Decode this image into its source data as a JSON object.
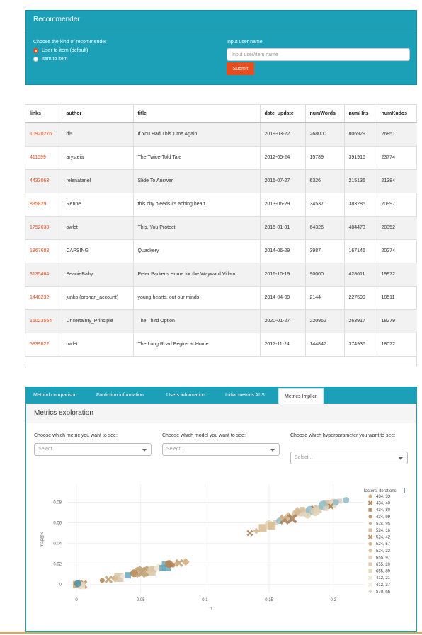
{
  "recommender": {
    "title": "Recommender",
    "kind_label": "Choose the kind of recommender",
    "options": [
      "User to item (default)",
      "Item to item"
    ],
    "selected_index": 0,
    "input_label": "Input user name",
    "input_placeholder": "Input user/item name",
    "submit_label": "Submit"
  },
  "table": {
    "columns": [
      "links",
      "author",
      "title",
      "date_update",
      "numWords",
      "numHits",
      "numKudos"
    ],
    "rows": [
      [
        "10920276",
        "dls",
        "If You Had This Time Again",
        "2019-03-22",
        "268000",
        "806929",
        "26851"
      ],
      [
        "411599",
        "arysteia",
        "The Twice-Told Tale",
        "2012-05-24",
        "15789",
        "391916",
        "23774"
      ],
      [
        "4433063",
        "relenafanel",
        "Slide To Answer",
        "2015-07-27",
        "6326",
        "215136",
        "21384"
      ],
      [
        "835829",
        "Renne",
        "this city bleeds its aching heart",
        "2013-06-29",
        "34537",
        "383285",
        "20997"
      ],
      [
        "1752638",
        "owlet",
        "This, You Protect",
        "2015-01-01",
        "64326",
        "484473",
        "20352"
      ],
      [
        "1867683",
        "CAPSING",
        "Quackery",
        "2014-06-29",
        "3987",
        "167146",
        "20274"
      ],
      [
        "3135464",
        "BeanieBaby",
        "Peter Parker's Home for the Wayward Villain",
        "2016-10-19",
        "90000",
        "428611",
        "19972"
      ],
      [
        "1440232",
        "junko (orphan_account)",
        "young hearts, out our minds",
        "2014-04-09",
        "2144",
        "227599",
        "18511"
      ],
      [
        "16023554",
        "Uncertainty_Principle",
        "The Third Option",
        "2020-01-27",
        "220962",
        "263917",
        "18279"
      ],
      [
        "5339822",
        "owlet",
        "The Long Road Begins at Home",
        "2017-11-24",
        "144847",
        "374936",
        "18072"
      ]
    ]
  },
  "tabs": [
    "Method comparison",
    "Fanfiction information",
    "Users information",
    "Initial metrics ALS",
    "Metrics Implicit"
  ],
  "active_tab": 4,
  "metrics": {
    "title": "Metrics exploration",
    "metric_label": "Choose which metric you want to see:",
    "model_label": "Choose which model you want to see:",
    "hyper_label": "Choose which hyperparameter you want to see:",
    "select_placeholder": "Select..."
  },
  "chart_data": {
    "type": "scatter",
    "xlabel": "f1",
    "ylabel": "map@k",
    "xlim": [
      -0.005,
      0.22
    ],
    "ylim": [
      -0.005,
      0.092
    ],
    "xticks": [
      "0",
      "0.05",
      "0.1",
      "0.15",
      "0.2"
    ],
    "yticks": [
      "0",
      "0.02",
      "0.04",
      "0.06",
      "0.08"
    ],
    "legend_title": "factors, iterations",
    "legend_position": "right",
    "series": [
      {
        "name": "434, 33",
        "marker": "circle",
        "color": "#c8a06a"
      },
      {
        "name": "434, 40",
        "marker": "x",
        "color": "#b5804a"
      },
      {
        "name": "434, 80",
        "marker": "square",
        "color": "#a9825b"
      },
      {
        "name": "434, 99",
        "marker": "circle",
        "color": "#b58a55"
      },
      {
        "name": "524, 95",
        "marker": "diamond",
        "color": "#c2a27a"
      },
      {
        "name": "524, 16",
        "marker": "square",
        "color": "#d4b48c"
      },
      {
        "name": "524, 42",
        "marker": "x",
        "color": "#c08a58"
      },
      {
        "name": "524, 57",
        "marker": "circle",
        "color": "#d2a878"
      },
      {
        "name": "524, 32",
        "marker": "circle",
        "color": "#d8bc90"
      },
      {
        "name": "655, 97",
        "marker": "square",
        "color": "#e0cba8"
      },
      {
        "name": "655, 20",
        "marker": "square",
        "color": "#d8c4a4"
      },
      {
        "name": "655, 89",
        "marker": "square",
        "color": "#e2d2b4"
      },
      {
        "name": "412, 21",
        "marker": "x",
        "color": "#ece2cc"
      },
      {
        "name": "412, 37",
        "marker": "x",
        "color": "#f0e8d6"
      },
      {
        "name": "570, 66",
        "marker": "plus",
        "color": "#d8cdbc"
      }
    ],
    "clusters": [
      {
        "x": [
          0.0,
          0.003,
          0.005,
          0.002,
          0.004,
          0.001
        ],
        "y": [
          0.0,
          0.001,
          0.0,
          0.002,
          -0.001,
          0.001
        ]
      },
      {
        "x": [
          0.02,
          0.025,
          0.03,
          0.033,
          0.036,
          0.04,
          0.045,
          0.05,
          0.055,
          0.06,
          0.065,
          0.07,
          0.075,
          0.08,
          0.085,
          0.058,
          0.062,
          0.067,
          0.072,
          0.052,
          0.078
        ],
        "y": [
          0.004,
          0.005,
          0.006,
          0.007,
          0.008,
          0.009,
          0.011,
          0.012,
          0.014,
          0.015,
          0.017,
          0.018,
          0.019,
          0.021,
          0.022,
          0.013,
          0.016,
          0.016,
          0.02,
          0.013,
          0.021
        ]
      },
      {
        "x": [
          0.135,
          0.14,
          0.145,
          0.15,
          0.155,
          0.158,
          0.162,
          0.165,
          0.17,
          0.174,
          0.178,
          0.182,
          0.185,
          0.19,
          0.195,
          0.2,
          0.205,
          0.21,
          0.168,
          0.172,
          0.176,
          0.18,
          0.188,
          0.192,
          0.198,
          0.16,
          0.152,
          0.186,
          0.194,
          0.202
        ],
        "y": [
          0.05,
          0.052,
          0.055,
          0.058,
          0.06,
          0.062,
          0.063,
          0.066,
          0.068,
          0.069,
          0.07,
          0.072,
          0.074,
          0.075,
          0.078,
          0.079,
          0.081,
          0.082,
          0.064,
          0.071,
          0.073,
          0.067,
          0.073,
          0.077,
          0.076,
          0.065,
          0.057,
          0.071,
          0.074,
          0.08
        ]
      }
    ]
  }
}
